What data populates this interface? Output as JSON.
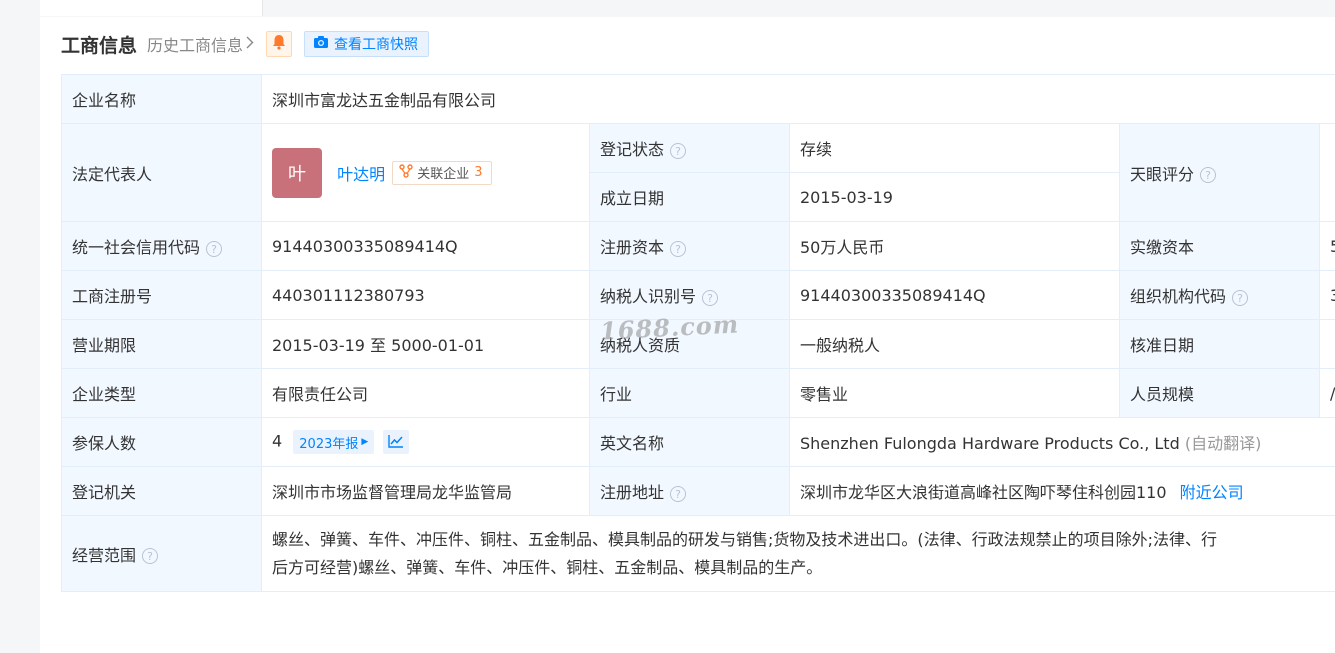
{
  "header": {
    "title": "工商信息",
    "history_label": "历史工商信息",
    "snapshot_label": "查看工商快照"
  },
  "company": {
    "name_label": "企业名称",
    "name_value": "深圳市富龙达五金制品有限公司",
    "legal_rep_label": "法定代表人",
    "legal_rep_avatar": "叶",
    "legal_rep_name": "叶达明",
    "related_label": "关联企业",
    "related_count": "3",
    "status_label": "登记状态",
    "status_value": "存续",
    "founded_label": "成立日期",
    "founded_value": "2015-03-19",
    "score_label": "天眼评分",
    "credit_code_label": "统一社会信用代码",
    "credit_code_value": "91440300335089414Q",
    "reg_capital_label": "注册资本",
    "reg_capital_value": "50万人民币",
    "paid_capital_label": "实缴资本",
    "paid_capital_value": "5",
    "reg_no_label": "工商注册号",
    "reg_no_value": "440301112380793",
    "taxpayer_id_label": "纳税人识别号",
    "taxpayer_id_value": "91440300335089414Q",
    "org_code_label": "组织机构代码",
    "org_code_value": "3",
    "term_label": "营业期限",
    "term_value": "2015-03-19 至 5000-01-01",
    "taxpayer_qual_label": "纳税人资质",
    "taxpayer_qual_value": "一般纳税人",
    "approval_label": "核准日期",
    "type_label": "企业类型",
    "type_value": "有限责任公司",
    "industry_label": "行业",
    "industry_value": "零售业",
    "staff_label": "人员规模",
    "staff_value": "/",
    "insured_label": "参保人数",
    "insured_value": "4",
    "report_label": "2023年报",
    "en_name_label": "英文名称",
    "en_name_value": "Shenzhen Fulongda Hardware Products Co., Ltd",
    "auto_translate": "(自动翻译)",
    "authority_label": "登记机关",
    "authority_value": "深圳市市场监督管理局龙华监管局",
    "address_label": "注册地址",
    "address_value": "深圳市龙华区大浪街道高峰社区陶吓琴住科创园110",
    "nearby_label": "附近公司",
    "scope_label": "经营范围",
    "scope_line1": "螺丝、弹簧、车件、冲压件、铜柱、五金制品、模具制品的研发与销售;货物及技术进出口。(法律、行政法规禁止的项目除外;法律、行",
    "scope_line2": "后方可经营)螺丝、弹簧、车件、冲压件、铜柱、五金制品、模具制品的生产。"
  },
  "watermark": "1688.com",
  "icons": {
    "bell": "bell-icon",
    "camera": "camera-icon",
    "question": "question-circle-icon",
    "relation": "relation-network-icon",
    "trend": "trend-chart-icon",
    "chevron": "chevron-right-icon"
  },
  "colors": {
    "accent": "#0084ff",
    "status_green": "#1aab5a",
    "label_bg": "#f2f8ff",
    "avatar_bg": "#c9717a",
    "count_orange": "#ff7a2d"
  }
}
